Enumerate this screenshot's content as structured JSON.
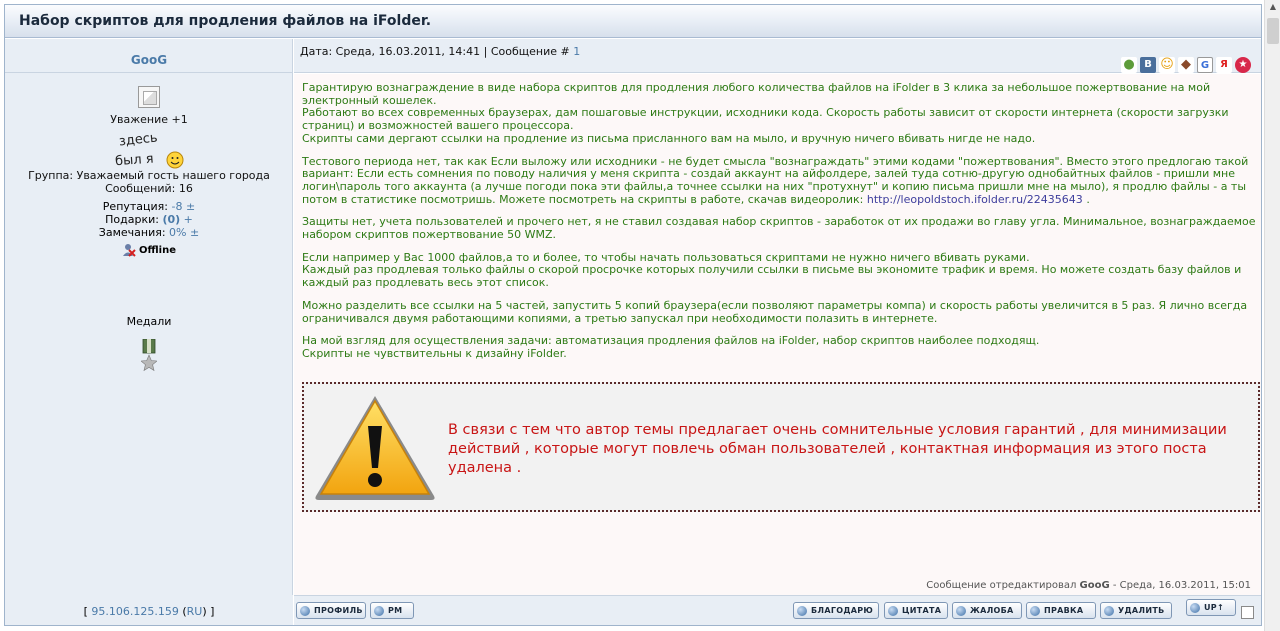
{
  "topic": {
    "title": "Набор скриптов для продления файлов на iFolder."
  },
  "author": {
    "name": "GooG",
    "respect": "Уважение +1",
    "status_image_text": "здесь был я",
    "group": "Группа: Уважаемый гость нашего города",
    "posts": "Сообщений: 16",
    "reputation_label": "Репутация:",
    "reputation_value": "-8",
    "reputation_pm": "±",
    "gifts_label": "Подарки:",
    "gifts_value": "(0)",
    "gifts_plus": "+",
    "warnings_label": "Замечания:",
    "warnings_value": "0%",
    "warnings_pm": "±",
    "online_status": "Offline",
    "medals_label": "Медали",
    "ip_open": "[",
    "ip": "95.106.125.159",
    "ip_country_open": "(",
    "ip_country": "RU",
    "ip_country_close": ")",
    "ip_close": "]"
  },
  "post": {
    "header_text": "Дата: Среда, 16.03.2011, 14:41 | Сообщение #",
    "post_number": "1",
    "share_icons": [
      {
        "name": "moi-mir-icon",
        "glyph": "●",
        "color": "#5d9c3a"
      },
      {
        "name": "vkontakte-icon",
        "glyph": "В",
        "color": "#4a6f9c"
      },
      {
        "name": "odnoklassniki-icon",
        "glyph": "☺",
        "color": "#e6a215"
      },
      {
        "name": "liveinternet-icon",
        "glyph": "◆",
        "color": "#8a4a2a"
      },
      {
        "name": "google-icon",
        "glyph": "G",
        "color": "#ffffff"
      },
      {
        "name": "yandex-icon",
        "glyph": "Я",
        "color": "#ffffff"
      },
      {
        "name": "bookmark-star-icon",
        "glyph": "★",
        "color": "#d8284a"
      }
    ],
    "paragraphs": [
      [
        "Гарантирую вознаграждение в виде набора скриптов для продления любого количества файлов на iFolder в 3 клика за небольшое пожертвование на мой электронный кошелек.",
        "Работают во всех современных браузерах, дам пошаговые инструкции, исходники кода. Скорость работы зависит от скорости интернета (скорости загрузки страниц) и возможностей вашего процессора.",
        "Скрипты сами дергают ссылки на продление из письма присланного вам на мыло, и вручную ничего вбивать нигде не надо."
      ],
      [
        "Тестового периода нет, так как Если выложу или исходники - не будет смысла \"вознаграждать\" этими кодами \"пожертвования\". Вместо этого предлогаю такой вариант: Если есть сомнения по поводу наличия у меня скрипта - создай аккаунт на айфолдере, залей туда сотню-другую однобайтных файлов - пришли мне логин\\пароль того аккаунта (а лучше погоди пока эти файлы,а точнее ссылки на них \"протухнут\" и копию письма пришли мне на мыло), я продлю файлы - а ты потом в статистике посмотришь. Можете посмотреть на скрипты в работе, скачав видеоролик:"
      ],
      [
        "Защиты нет, учета пользователей и прочего нет, я не ставил создавая набор скриптов - заработок от их продажи во главу угла. Минимальное, вознаграждаемое набором скриптов пожертвование 50 WMZ."
      ],
      [
        "Если например у Вас 1000 файлов,а то и более, то чтобы начать пользоваться скриптами не нужно ничего вбивать руками.",
        "Каждый раз продлевая только файлы о скорой просрочке которых получили ссылки в письме вы экономите трафик и время. Но можете создать базу файлов и каждый раз продлевать весь этот список."
      ],
      [
        "Можно разделить все ссылки на 5 частей, запустить 5 копий браузера(если позволяют параметры компа) и скорость работы увеличится в 5 раз. Я лично всегда ограничивался двумя работающими копиями, а третью запускал при необходимости полазить в интернете."
      ],
      [
        "На мой взгляд для осуществления задачи: автоматизация продления файлов на iFolder, набор скриптов наиболее подходящ.",
        "Скрипты не чувствительны к дизайну iFolder."
      ]
    ],
    "video_link": "http://leopoldstoch.ifolder.ru/22435643",
    "video_link_suffix": ".",
    "warning_text": "В связи с тем что автор темы предлагает очень сомнительные условия гарантий , для минимизации действий , которые могут повлечь обман пользователей , контактная информация из этого поста удалена .",
    "edited_prefix": "Сообщение отредактировал",
    "edited_by": "GooG",
    "edited_suffix": "- Среда, 16.03.2011, 15:01"
  },
  "buttons": {
    "profile": "ПРОФИЛЬ",
    "pm": "PM",
    "thank": "БЛАГОДАРЮ",
    "quote": "ЦИТАТА",
    "complaint": "ЖАЛОБА",
    "edit": "ПРАВКА",
    "delete": "УДАЛИТЬ",
    "up": "UP↑"
  }
}
